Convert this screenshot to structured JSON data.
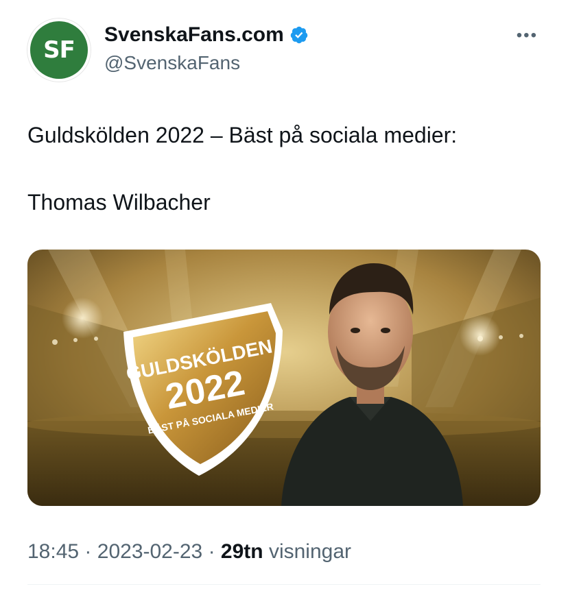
{
  "author": {
    "display_name": "SvenskaFans.com",
    "handle": "@SvenskaFans",
    "avatar_text": "SF",
    "verified": true
  },
  "tweet": {
    "line1": "Guldskölden 2022 – Bäst på sociala medier:",
    "line2": "Thomas Wilbacher"
  },
  "media": {
    "badge_title": "GULDSKÖLDEN",
    "badge_year": "2022",
    "badge_subtitle": "BÄST PÅ SOCIALA MEDIER"
  },
  "meta": {
    "time": "18:45",
    "separator": "·",
    "date": "2023-02-23",
    "views_count": "29tn",
    "views_label": "visningar"
  },
  "colors": {
    "brand_green": "#2f7d3d",
    "verified_blue": "#1d9bf0",
    "muted_text": "#536471",
    "gold": "#c9a24a"
  }
}
